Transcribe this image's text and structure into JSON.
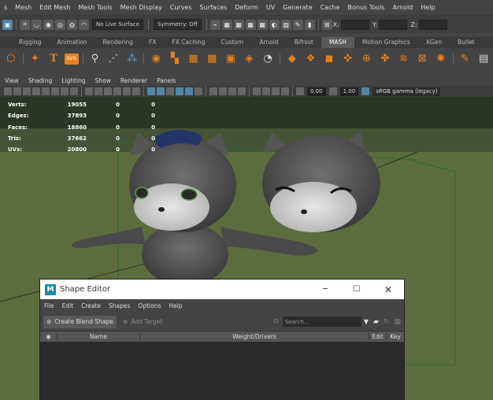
{
  "menubar": {
    "items": [
      "s",
      "Mesh",
      "Edit Mesh",
      "Mesh Tools",
      "Mesh Display",
      "Curves",
      "Surfaces",
      "Deform",
      "UV",
      "Generate",
      "Cache",
      "Bonus Tools",
      "Arnold",
      "Help"
    ]
  },
  "statusline": {
    "live_surface": "No Live Surface",
    "symmetry": "Symmetry: Off",
    "x_label": "X:",
    "y_label": "Y:",
    "z_label": "Z:"
  },
  "shelf_tabs": [
    "Rigging",
    "Animation",
    "Rendering",
    "FX",
    "FX Caching",
    "Custom",
    "Arnold",
    "Bifrost",
    "MASH",
    "Motion Graphics",
    "XGen",
    "Bullet"
  ],
  "shelf": {
    "text_icon": "T",
    "svg_icon": "SVG"
  },
  "panel_menu": [
    "View",
    "Shading",
    "Lighting",
    "Show",
    "Renderer",
    "Panels"
  ],
  "panel_toolbar": {
    "value1": "0.00",
    "value2": "1.00",
    "color_space": "sRGB gamma (legacy)"
  },
  "hud": [
    {
      "label": "Verts:",
      "v1": "19055",
      "v2": "0",
      "v3": "0"
    },
    {
      "label": "Edges:",
      "v1": "37893",
      "v2": "0",
      "v3": "0"
    },
    {
      "label": "Faces:",
      "v1": "18860",
      "v2": "0",
      "v3": "0"
    },
    {
      "label": "Tris:",
      "v1": "37662",
      "v2": "0",
      "v3": "0"
    },
    {
      "label": "UVs:",
      "v1": "20800",
      "v2": "0",
      "v3": "0"
    }
  ],
  "shape_editor": {
    "title": "Shape Editor",
    "menu": [
      "File",
      "Edit",
      "Create",
      "Shapes",
      "Options",
      "Help"
    ],
    "create_blend_shape": "Create Blend Shape",
    "add_target": "Add Target",
    "search_placeholder": "Search...",
    "col_name": "Name",
    "col_weight": "Weight/Drivers",
    "col_edit": "Edit",
    "col_key": "Key"
  },
  "colors": {
    "accent_blue": "#5285a6",
    "shelf_orange": "#e8821e",
    "bg": "#444444"
  }
}
